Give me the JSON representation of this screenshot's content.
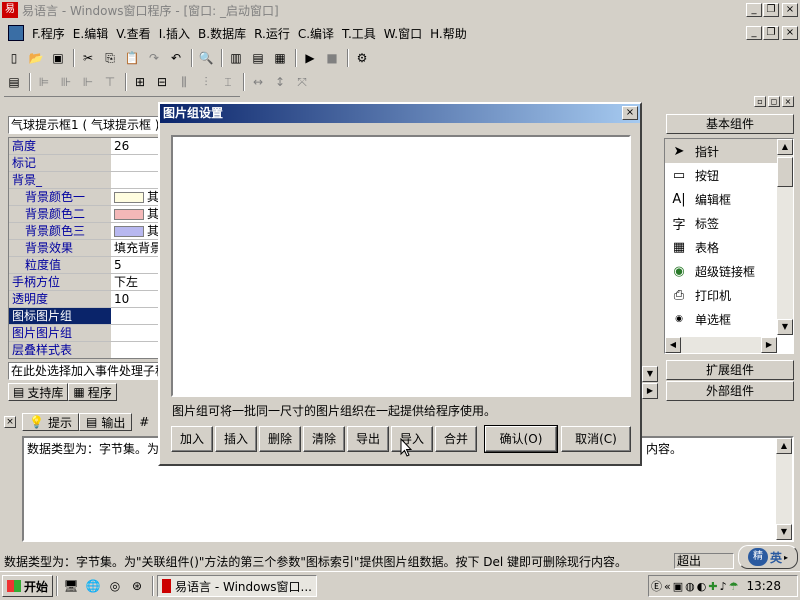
{
  "window": {
    "title": "易语言 - Windows窗口程序 - [窗口: _启动窗口]"
  },
  "menu": [
    {
      "label": "F.程序"
    },
    {
      "label": "E.编辑"
    },
    {
      "label": "V.查看"
    },
    {
      "label": "I.插入"
    },
    {
      "label": "B.数据库"
    },
    {
      "label": "R.运行"
    },
    {
      "label": "C.编译"
    },
    {
      "label": "T.工具"
    },
    {
      "label": "W.窗口"
    },
    {
      "label": "H.帮助"
    }
  ],
  "property_panel": {
    "object": "气球提示框1 ( 气球提示框 )",
    "rows": [
      {
        "name": "高度",
        "value": "26"
      },
      {
        "name": "标记",
        "value": ""
      },
      {
        "name": "背景_",
        "value": ""
      },
      {
        "name": "背景颜色一",
        "value": "其",
        "swatch": "#fffde0"
      },
      {
        "name": "背景颜色二",
        "value": "其",
        "swatch": "#f4b8b8"
      },
      {
        "name": "背景颜色三",
        "value": "其",
        "swatch": "#b8b8f0"
      },
      {
        "name": "背景效果",
        "value": "填充背景"
      },
      {
        "name": "粒度值",
        "value": "5"
      },
      {
        "name": "手柄方位",
        "value": "下左"
      },
      {
        "name": "透明度",
        "value": "10"
      },
      {
        "name": "图标图片组",
        "value": ""
      },
      {
        "name": "图片图片组",
        "value": ""
      },
      {
        "name": "层叠样式表",
        "value": ""
      }
    ],
    "event_hint": "在此处选择加入事件处理子程序",
    "tabs": {
      "support": "支持库",
      "program": "程序"
    }
  },
  "output_panel": {
    "tabs": {
      "hint": "提示",
      "output": "输出"
    },
    "text_start": "数据类型为：字节集。为",
    "text_end": "内容。"
  },
  "dialog": {
    "title": "图片组设置",
    "description": "图片组可将一批同一尺寸的图片组织在一起提供给程序使用。",
    "buttons": {
      "add": "加入",
      "insert": "插入",
      "delete": "删除",
      "clear": "清除",
      "export": "导出",
      "import": "导入",
      "merge": "合并",
      "ok": "确认(O)",
      "cancel": "取消(C)"
    }
  },
  "right_panel": {
    "basic_header": "基本组件",
    "items": [
      {
        "label": "指针",
        "icon": "pointer-icon",
        "glyph": "➤"
      },
      {
        "label": "按钮",
        "icon": "button-icon",
        "glyph": "▭"
      },
      {
        "label": "编辑框",
        "icon": "editbox-icon",
        "glyph": "A|"
      },
      {
        "label": "标签",
        "icon": "label-icon",
        "glyph": "字"
      },
      {
        "label": "表格",
        "icon": "table-icon",
        "glyph": "▦"
      },
      {
        "label": "超级链接框",
        "icon": "hyperlink-icon",
        "glyph": "◉"
      },
      {
        "label": "打印机",
        "icon": "printer-icon",
        "glyph": "⎙"
      },
      {
        "label": "单选框",
        "icon": "radio-icon",
        "glyph": "◉"
      }
    ],
    "extended": "扩展组件",
    "external": "外部组件"
  },
  "statusbar": {
    "text": "数据类型为：字节集。为\"关联组件()\"方法的第三个参数\"图标索引\"提供图片组数据。按下 Del 键即可删除现行内容。",
    "mode": "超出"
  },
  "ime": {
    "label": "英"
  },
  "taskbar": {
    "start": "开始",
    "task": "易语言 - Windows窗口...",
    "clock": "13:28"
  }
}
